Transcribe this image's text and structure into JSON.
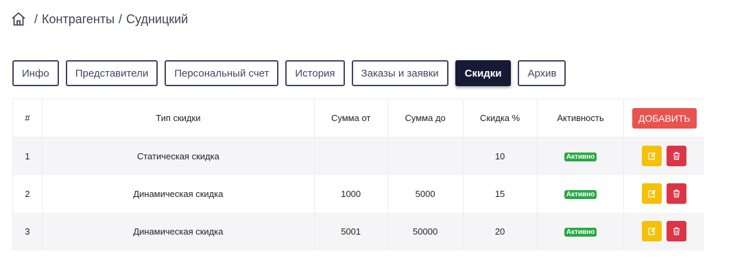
{
  "breadcrumb": {
    "items": [
      "Контрагенты",
      "Судницкий"
    ],
    "separator": "/"
  },
  "tabs": [
    {
      "label": "Инфо",
      "active": false
    },
    {
      "label": "Представители",
      "active": false
    },
    {
      "label": "Персональный счет",
      "active": false
    },
    {
      "label": "История",
      "active": false
    },
    {
      "label": "Заказы и заявки",
      "active": false
    },
    {
      "label": "Скидки",
      "active": true
    },
    {
      "label": "Архив",
      "active": false
    }
  ],
  "table": {
    "columns": [
      "#",
      "Тип скидки",
      "Сумма от",
      "Сумма до",
      "Скидка %",
      "Активность"
    ],
    "add_button": "ДОБАВИТЬ",
    "rows": [
      {
        "num": "1",
        "type": "Статическая скидка",
        "from": "",
        "to": "",
        "discount": "10",
        "status": "Активно"
      },
      {
        "num": "2",
        "type": "Динамическая скидка",
        "from": "1000",
        "to": "5000",
        "discount": "15",
        "status": "Активно"
      },
      {
        "num": "3",
        "type": "Динамическая скидка",
        "from": "5001",
        "to": "50000",
        "discount": "20",
        "status": "Активно"
      }
    ]
  },
  "colors": {
    "active_tab": "#171a36",
    "add_button": "#e9524e",
    "badge": "#27a844",
    "edit": "#f6c00a",
    "delete": "#dc3545"
  },
  "icons": {
    "home": "home-icon",
    "edit": "edit-icon",
    "delete": "trash-icon"
  }
}
